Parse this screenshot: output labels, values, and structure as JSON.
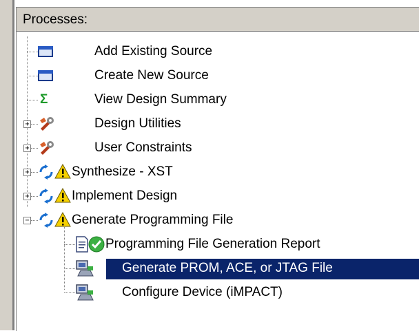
{
  "panel": {
    "title": "Processes:"
  },
  "items": [
    {
      "label": "Add Existing Source",
      "icon": "window-icon"
    },
    {
      "label": "Create New Source",
      "icon": "window-icon"
    },
    {
      "label": "View Design Summary",
      "icon": "sigma-icon"
    },
    {
      "label": "Design Utilities",
      "icon": "tools-icon",
      "expander": "+"
    },
    {
      "label": "User Constraints",
      "icon": "tools-icon",
      "expander": "+"
    },
    {
      "label": "Synthesize - XST",
      "icon": "refresh-warning-icon",
      "expander": "+"
    },
    {
      "label": "Implement Design",
      "icon": "refresh-warning-icon",
      "expander": "+"
    },
    {
      "label": "Generate Programming File",
      "icon": "refresh-warning-icon",
      "expander": "−"
    },
    {
      "label": "Programming File Generation Report",
      "icon": "report-check-icon"
    },
    {
      "label": "Generate PROM, ACE, or JTAG File",
      "icon": "device-program-icon",
      "selected": true
    },
    {
      "label": "Configure Device (iMPACT)",
      "icon": "device-program-icon"
    }
  ],
  "colors": {
    "selection": "#0a246a",
    "header_bg": "#d4d0c8"
  }
}
